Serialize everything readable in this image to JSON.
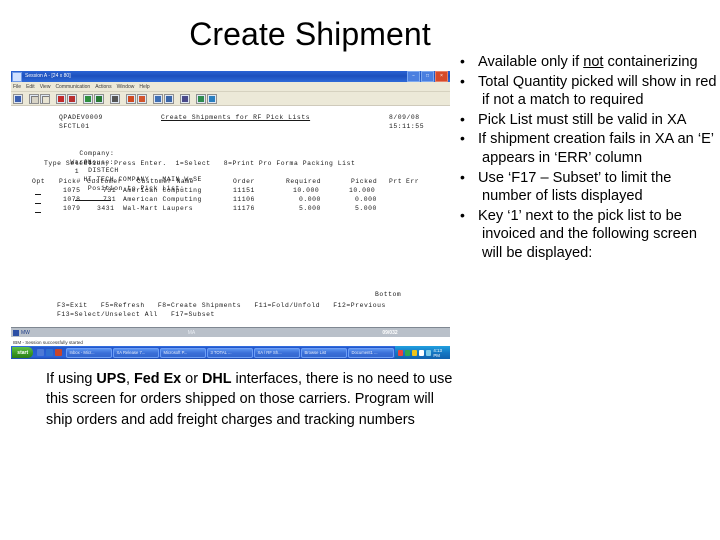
{
  "slide": {
    "title": "Create Shipment"
  },
  "screenshot": {
    "window": {
      "title": "Session A - [24 x 80]",
      "minimize_label": "–",
      "maximize_label": "□",
      "close_label": "×",
      "menus": [
        "File",
        "Edit",
        "View",
        "Communication",
        "Actions",
        "Window",
        "Help"
      ],
      "toolbar_icons": [
        "new-session-icon",
        "copy-icon",
        "paste-icon",
        "send-receive-icon",
        "receive-file-icon",
        "display-icon",
        "print-icon",
        "keyboard-icon",
        "macro-record-icon",
        "macro-play-icon",
        "transfer-icon",
        "transfer-setup-icon",
        "index-icon",
        "color-icon",
        "help-pointer-icon"
      ]
    },
    "terminal": {
      "device": "QPADEV0009",
      "program": "SFCTL01",
      "title": "Create Shipments for RF Pick Lists",
      "date": "8/09/08",
      "time": "15:11:55",
      "company_label": "Company:",
      "company_number": "01",
      "company_name": "DISTECH",
      "warehouse_label": "Warehouse:",
      "warehouse_number": "1",
      "warehouse_name": "HI-TECH COMPANY - MAIN W=SE",
      "position_label": "Position to Pick List:",
      "position_value": "",
      "instruction": "Type Selection, Press Enter.  1=Select   8=Print Pro Forma Packing List",
      "columns": [
        "Opt",
        "Pick#",
        "Customer",
        "Customer Name",
        "Order",
        "Required",
        "Picked",
        "Prt",
        "Err"
      ],
      "rows": [
        {
          "opt": "_",
          "pick": "1075",
          "customer": "731",
          "name": "American Computing",
          "order": "11151",
          "required": "10.000",
          "picked": "10.000",
          "prt": "",
          "err": ""
        },
        {
          "opt": "_",
          "pick": "1078",
          "customer": "731",
          "name": "American Computing",
          "order": "11106",
          "required": "0.000",
          "picked": "0.000",
          "prt": "",
          "err": ""
        },
        {
          "opt": "_",
          "pick": "1079",
          "customer": "3431",
          "name": "Wal-Mart Laupers",
          "order": "11176",
          "required": "5.000",
          "picked": "5.000",
          "prt": "",
          "err": ""
        }
      ],
      "bottom_indicator": "Bottom",
      "function_keys_line1": "F3=Exit   F5=Refresh   F8=Create Shipments   F11=Fold/Unfold   F12=Previous",
      "function_keys_line2": "F13=Select/Unselect All   F17=Subset"
    },
    "status_bar": {
      "left_indicator": "MW",
      "middle": "MA",
      "position": "09/032"
    },
    "os": {
      "message": "IBM - Session successfully started",
      "start_label": "start",
      "taskbar_items": [
        "Inbox - Micr...",
        "XA Release 7...",
        "Microsoft P...",
        "3 TOTAL ...",
        "XA / RF Sh...",
        "Browse List",
        "Document1 ...",
        ""
      ],
      "clock": "4:13 PM"
    }
  },
  "bullets": [
    {
      "text_before": "Available only if ",
      "underlined": "not",
      "text_after": " containerizing"
    },
    {
      "text_before": "Total Quantity picked will show in red if not a match to required",
      "underlined": "",
      "text_after": ""
    },
    {
      "text_before": "Pick List must still be valid in XA",
      "underlined": "",
      "text_after": ""
    },
    {
      "text_before": "If shipment creation fails in XA an ‘E’ appears in ‘ERR’ column",
      "underlined": "",
      "text_after": ""
    },
    {
      "text_before": "Use ‘F17 – Subset’ to limit the number of lists displayed",
      "underlined": "",
      "text_after": ""
    },
    {
      "text_before": "Key ‘1’ next to the pick list to be invoiced and the following screen will be displayed:",
      "underlined": "",
      "text_after": ""
    }
  ],
  "caption": {
    "part1": "If using ",
    "bold1": "UPS",
    "part2": ", ",
    "bold2": "Fed Ex",
    "part3": " or ",
    "bold3": "DHL",
    "part4": " interfaces, there is no need to use this screen for orders shipped on those carriers. Program will ship orders and add freight charges and tracking numbers"
  }
}
